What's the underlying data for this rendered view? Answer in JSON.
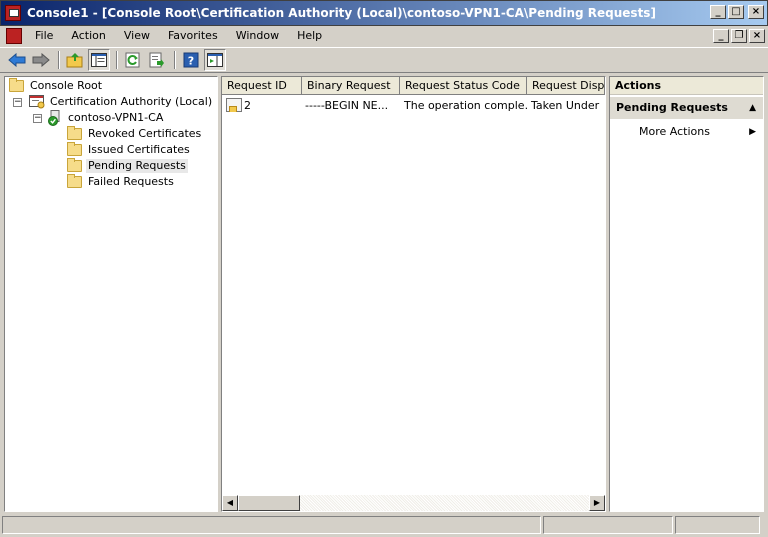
{
  "window": {
    "title": "Console1 - [Console Root\\Certification Authority (Local)\\contoso-VPN1-CA\\Pending Requests]",
    "buttons": {
      "minimize": "_",
      "maximize": "□",
      "close": "×"
    },
    "mdi_buttons": {
      "minimize": "_",
      "restore": "❐",
      "close": "×"
    }
  },
  "menu": [
    "File",
    "Action",
    "View",
    "Favorites",
    "Window",
    "Help"
  ],
  "toolbar": [
    {
      "icon": "back-arrow-icon"
    },
    {
      "icon": "forward-arrow-icon"
    },
    {
      "icon": "up-folder-icon"
    },
    {
      "icon": "show-hide-tree-icon"
    },
    {
      "icon": "refresh-icon"
    },
    {
      "icon": "export-list-icon"
    },
    {
      "icon": "help-icon"
    },
    {
      "icon": "show-hide-action-pane-icon"
    }
  ],
  "tree": {
    "root": "Console Root",
    "ca": "Certification Authority (Local)",
    "server": "contoso-VPN1-CA",
    "folders": [
      "Revoked Certificates",
      "Issued Certificates",
      "Pending Requests",
      "Failed Requests"
    ],
    "selected_index": 2,
    "expander_collapse": "−"
  },
  "list": {
    "columns": [
      "Request ID",
      "Binary Request",
      "Request Status Code",
      "Request Dispos"
    ],
    "rows": [
      {
        "id": "2",
        "binary": "-----BEGIN NE...",
        "status": "The operation comple...",
        "disposition": "Taken Under S"
      }
    ],
    "scroll_left": "◀",
    "scroll_right": "▶"
  },
  "actions": {
    "title": "Actions",
    "section": "Pending Requests",
    "section_caret": "▲",
    "more": "More Actions",
    "more_arrow": "▶"
  },
  "colors": {
    "title_start": "#0a246a",
    "title_end": "#a6caf0",
    "chrome": "#d4d0c8"
  }
}
